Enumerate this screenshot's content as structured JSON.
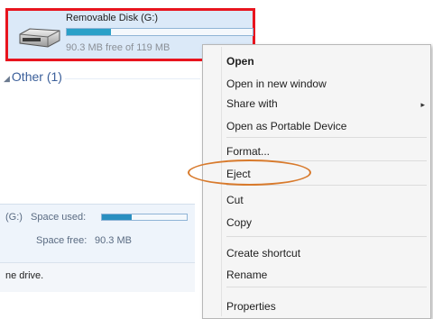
{
  "drive": {
    "title": "Removable Disk (G:)",
    "free_text": "90.3 MB free of 119 MB",
    "used_fraction": 0.24,
    "icon": "removable-drive-icon"
  },
  "section": {
    "label": "Other (1)",
    "icon": "collapse-arrow-icon"
  },
  "details": {
    "drive_letter": "(G:)",
    "space_used_label": "Space used:",
    "space_used_fraction": 0.35,
    "space_free_label": "Space free:",
    "space_free_value": "90.3 MB"
  },
  "status": {
    "text": "ne drive."
  },
  "context_menu": {
    "items": [
      {
        "label": "Open",
        "bold": true
      },
      {
        "label": "Open in new window"
      },
      {
        "label": "Share with",
        "submenu": true
      },
      {
        "label": "Open as Portable Device"
      },
      {
        "label": "Format..."
      },
      {
        "label": "Eject",
        "highlighted": true
      },
      {
        "label": "Cut"
      },
      {
        "label": "Copy"
      },
      {
        "label": "Create shortcut"
      },
      {
        "label": "Rename"
      },
      {
        "label": "Properties"
      }
    ],
    "submenu_arrow": "▸"
  },
  "colors": {
    "selection_border": "#e8141e",
    "eject_highlight": "#d87a2c",
    "tile_background": "#dbe9f8"
  }
}
